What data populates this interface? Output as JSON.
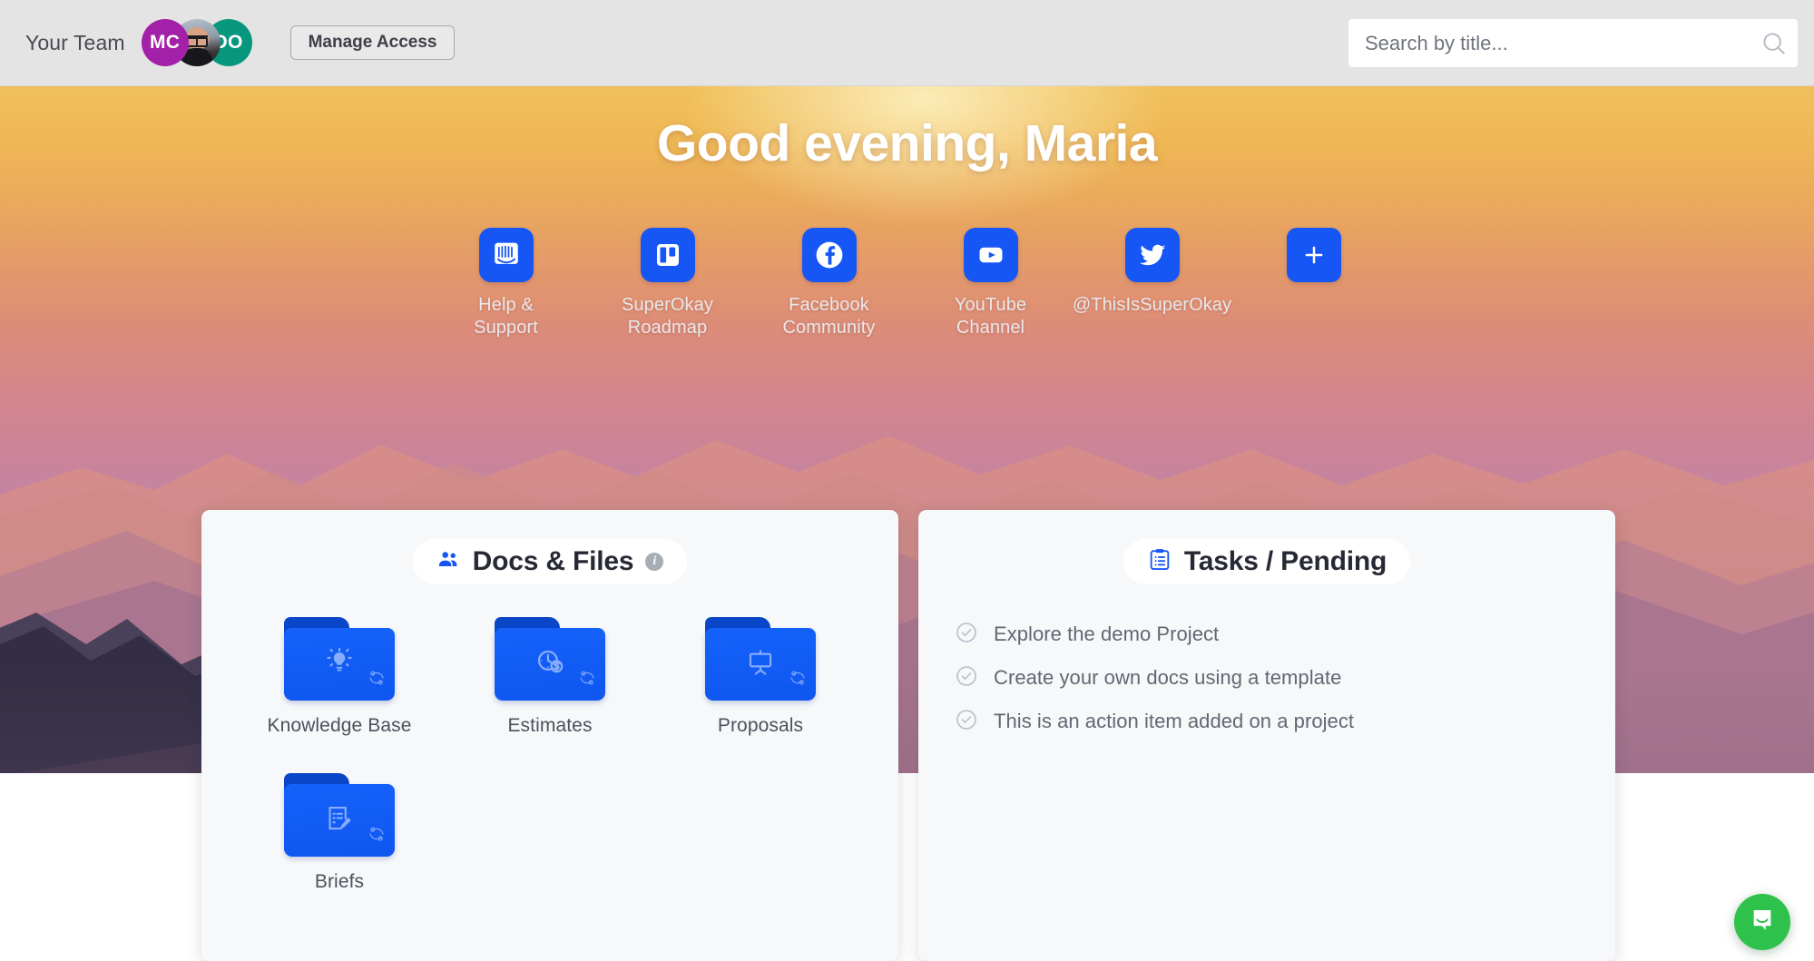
{
  "topbar": {
    "team_label": "Your Team",
    "avatars": [
      {
        "initials": "MC",
        "color": "#a320a8",
        "type": "initials"
      },
      {
        "initials": "",
        "color": "#8e9aa6",
        "type": "photo"
      },
      {
        "initials": "DO",
        "color": "#07977f",
        "type": "initials"
      }
    ],
    "manage_access_label": "Manage Access",
    "search_placeholder": "Search by title...",
    "search_value": "",
    "search_icon": "search-icon"
  },
  "hero": {
    "greeting": "Good evening, Maria",
    "shortcuts": [
      {
        "label": "Help &\nSupport",
        "icon": "intercom-icon"
      },
      {
        "label": "SuperOkay\nRoadmap",
        "icon": "trello-icon"
      },
      {
        "label": "Facebook\nCommunity",
        "icon": "facebook-icon"
      },
      {
        "label": "YouTube\nChannel",
        "icon": "youtube-icon"
      },
      {
        "label": "@ThisIsSuperOkay",
        "icon": "twitter-icon"
      },
      {
        "label": "",
        "icon": "plus-icon"
      }
    ],
    "accent_color": "#1656f5"
  },
  "docs_card": {
    "title": "Docs & Files",
    "header_icon": "people-icon",
    "info_badge": "i",
    "folders": [
      {
        "name": "Knowledge Base",
        "icon": "lightbulb-icon",
        "badge": "share-icon"
      },
      {
        "name": "Estimates",
        "icon": "clock-dollar-icon",
        "badge": "share-icon"
      },
      {
        "name": "Proposals",
        "icon": "presentation-board-icon",
        "badge": "share-icon"
      },
      {
        "name": "Briefs",
        "icon": "document-pencil-icon",
        "badge": "share-icon"
      }
    ]
  },
  "tasks_card": {
    "title": "Tasks / Pending",
    "header_icon": "clipboard-list-icon",
    "items": [
      {
        "text": "Explore the demo Project",
        "icon": "check-circle-icon",
        "done": false
      },
      {
        "text": "Create your own docs using a template",
        "icon": "check-circle-icon",
        "done": false
      },
      {
        "text": "This is an action item added on a project",
        "icon": "check-circle-icon",
        "done": false
      }
    ]
  },
  "chat": {
    "icon": "intercom-chat-icon",
    "color": "#2ec14b"
  }
}
